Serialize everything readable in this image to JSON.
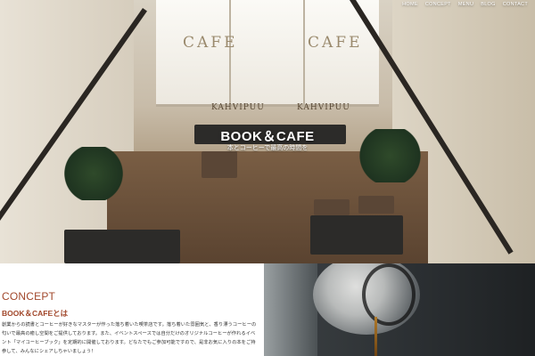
{
  "nav": {
    "items": [
      "HOME",
      "CONCEPT",
      "MENU",
      "BLOG",
      "CONTACT"
    ]
  },
  "hero": {
    "brand": "BOOK＆CAFE",
    "tagline": "本とコーヒーで最高の時間を",
    "window_sign_left": "CAFE",
    "window_sign_right": "CAFE",
    "kahvi_left": "KAHVIPUU",
    "kahvi_right": "KAHVIPUU"
  },
  "concept": {
    "heading": "CONCEPT",
    "subheading": "BOOK＆CAFEとは",
    "body": "創業からの読書とコーヒーが好きなマスターが作った落ち着いた喫茶店です。落ち着いた雰囲気と、香り漂うコーヒーの匂いで最高の癒し空間をご提供しております。また、イベントスペースでは自分だけのオリジナルコーヒーが作れるイベント「マイコーヒーブック」を定期的に開催しております。どなたでもご参加可能ですので、是非お気に入りの本をご持参して、みんなにシェアしちゃいましょう！"
  }
}
